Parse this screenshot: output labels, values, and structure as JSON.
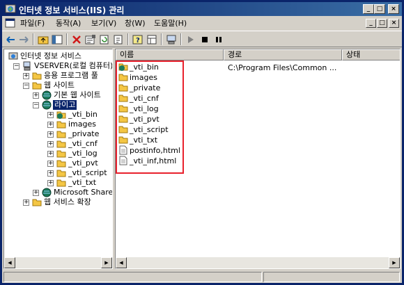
{
  "window": {
    "title": "인터넷 정보 서비스(IIS) 관리",
    "minimize_glyph": "_",
    "maximize_glyph": "□",
    "close_glyph": "×"
  },
  "menu": {
    "items": [
      {
        "label": "파일(F)"
      },
      {
        "label": "동작(A)"
      },
      {
        "label": "보기(V)"
      },
      {
        "label": "창(W)"
      },
      {
        "label": "도움말(H)"
      }
    ]
  },
  "tree": {
    "root": "인터넷 정보 서비스",
    "server": "VSERVER(로컬 컴퓨터)",
    "app_pools": "응용 프로그램 풀",
    "websites": "웹 사이트",
    "default_site": "기본 웹 사이트",
    "selected_site": "라이고",
    "children": [
      "_vti_bin",
      "images",
      "_private",
      "_vti_cnf",
      "_vti_log",
      "_vti_pvt",
      "_vti_script",
      "_vti_txt"
    ],
    "ms_share": "Microsoft Share",
    "web_ext": "웹 서비스 확장"
  },
  "list": {
    "columns": [
      "이름",
      "경로",
      "상태"
    ],
    "rows": [
      {
        "name": "_vti_bin",
        "icon": "globe-folder-icon"
      },
      {
        "name": "images",
        "icon": "folder-icon"
      },
      {
        "name": "_private",
        "icon": "folder-icon"
      },
      {
        "name": "_vti_cnf",
        "icon": "folder-icon"
      },
      {
        "name": "_vti_log",
        "icon": "folder-icon"
      },
      {
        "name": "_vti_pvt",
        "icon": "folder-icon"
      },
      {
        "name": "_vti_script",
        "icon": "folder-icon"
      },
      {
        "name": "_vti_txt",
        "icon": "folder-icon"
      },
      {
        "name": "postinfo,html",
        "icon": "document-icon"
      },
      {
        "name": "_vti_inf,html",
        "icon": "document-icon"
      }
    ],
    "first_row_path": "C:\\Program Files\\Common ..."
  },
  "colors": {
    "title_bar": "#0a246a",
    "highlight_box": "#e8202c",
    "folder": "#f4c644",
    "selection": "#0a246a"
  }
}
